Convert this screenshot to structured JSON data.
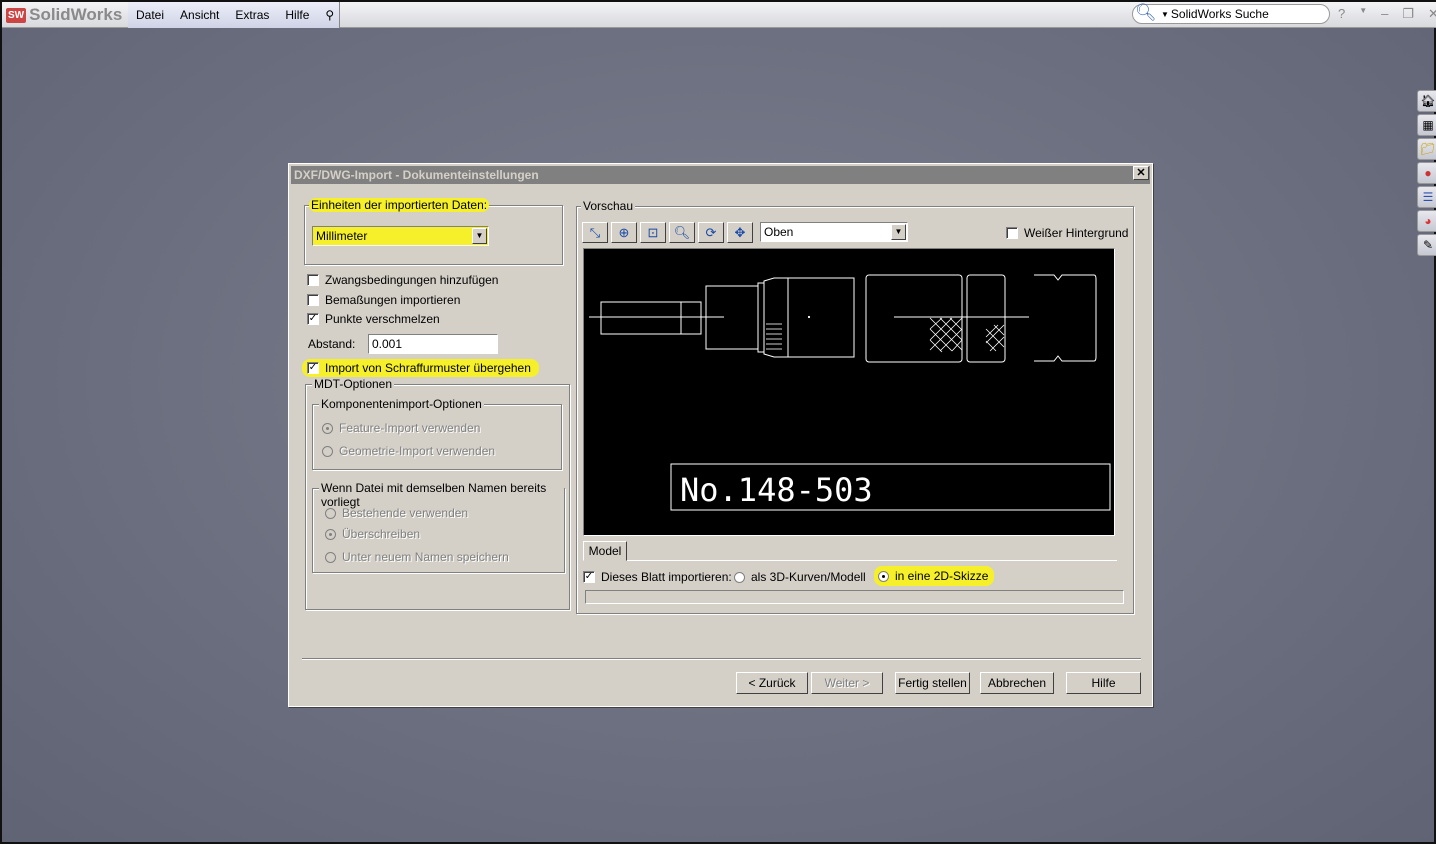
{
  "app": {
    "name": "SolidWorks",
    "menu": [
      "Datei",
      "Ansicht",
      "Extras",
      "Hilfe"
    ],
    "search_placeholder": "SolidWorks Suche",
    "help": "?",
    "minimize": "–",
    "restore": "❐",
    "close": "✕"
  },
  "side_icons": [
    "home-icon",
    "design-library-icon",
    "file-explorer-icon",
    "view-palette-icon",
    "appearances-icon",
    "scenes-icon",
    "custom-properties-icon"
  ],
  "dialog": {
    "title": "DXF/DWG-Import - Dokumenteinstellungen",
    "units_group": "Einheiten der importierten Daten:",
    "units_value": "Millimeter",
    "options": [
      {
        "label": "Zwangsbedingungen hinzufügen",
        "checked": false
      },
      {
        "label": "Bemaßungen importieren",
        "checked": false
      },
      {
        "label": "Punkte verschmelzen",
        "checked": true
      }
    ],
    "distance_label": "Abstand:",
    "distance_value": "0.001",
    "hatch_label": "Import von Schraffurmuster übergehen",
    "mdt_group": "MDT-Optionen",
    "component_group": "Komponentenimport-Optionen",
    "component_options": [
      "Feature-Import verwenden",
      "Geometrie-Import verwenden"
    ],
    "same_name_group": "Wenn Datei mit demselben Namen bereits vorliegt",
    "same_name_options": [
      "Bestehende verwenden",
      "Überschreiben",
      "Unter neuem Namen speichern"
    ],
    "preview_group": "Vorschau",
    "view_value": "Oben",
    "white_bg_label": "Weißer Hintergrund",
    "drawing_text": "No.148-503",
    "sheet_tab": "Model",
    "import_sheet_label": "Dieses Blatt importieren:",
    "as_3d_label": "als 3D-Kurven/Modell",
    "as_2d_label": "in eine 2D-Skizze",
    "buttons": {
      "back": "< Zurück",
      "next": "Weiter >",
      "finish": "Fertig stellen",
      "cancel": "Abbrechen",
      "help": "Hilfe"
    }
  },
  "colors": {
    "highlight": "#f5f02a",
    "title_bar": "#808080",
    "dialog_bg": "#d4d0c8"
  }
}
